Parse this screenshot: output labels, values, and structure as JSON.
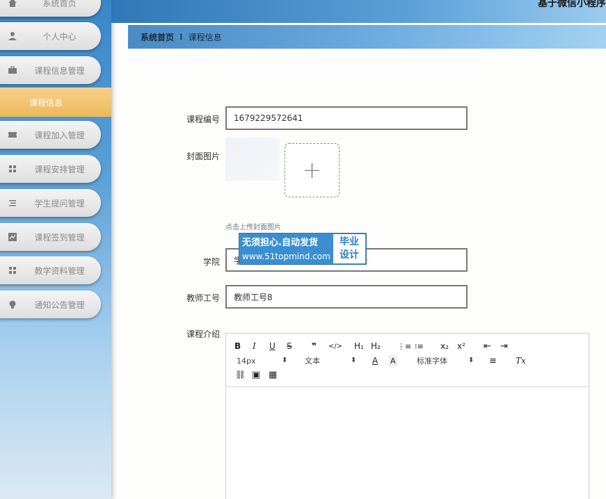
{
  "app": {
    "title": "基于微信小程序"
  },
  "sidebar": {
    "items": [
      {
        "label": "系统首页",
        "icon": "home-icon"
      },
      {
        "label": "个人中心",
        "icon": "user-icon"
      },
      {
        "label": "课程信息管理",
        "icon": "briefcase-icon"
      },
      {
        "label": "课程加入管理",
        "icon": "ticket-icon"
      },
      {
        "label": "课程安排管理",
        "icon": "grid-icon"
      },
      {
        "label": "学生提问管理",
        "icon": "list-icon"
      },
      {
        "label": "课程签到管理",
        "icon": "chart-icon"
      },
      {
        "label": "教学资料管理",
        "icon": "grid-icon"
      },
      {
        "label": "通知公告管理",
        "icon": "bulb-icon"
      }
    ],
    "active_item": "课程信息"
  },
  "breadcrumb": {
    "home": "系统首页",
    "separator": "⁝",
    "current": "课程信息"
  },
  "form": {
    "course_no": {
      "label": "课程编号",
      "value": "1679229572641"
    },
    "cover": {
      "label": "封面图片",
      "upload_symbol": "+",
      "hint": "点击上传封面图片"
    },
    "college": {
      "label": "学院",
      "value": "学"
    },
    "teacher_no": {
      "label": "教师工号",
      "value": "教师工号8"
    },
    "intro": {
      "label": "课程介绍"
    }
  },
  "editor": {
    "toolbar": {
      "bold": "B",
      "italic": "I",
      "underline": "U",
      "strike": "S",
      "quote": "❞",
      "code": "</>",
      "h1": "H₁",
      "h2": "H₂",
      "ordered_list": "⋮≡",
      "bullet_list": "⁝≡",
      "subscript": "x₂",
      "superscript": "x²",
      "outdent": "⇤",
      "indent": "⇥",
      "font_size": "14px",
      "format": "文本",
      "text_color": "A",
      "bg_color": "A",
      "font_family": "标准字体",
      "align": "≡",
      "clear": "Tx",
      "link": "⛓",
      "image": "▣",
      "video": "▦"
    }
  },
  "watermark": {
    "line1": "无须担心.自动发货",
    "line2": "www.51topmind.com",
    "badge1": "毕业",
    "badge2": "设计"
  }
}
